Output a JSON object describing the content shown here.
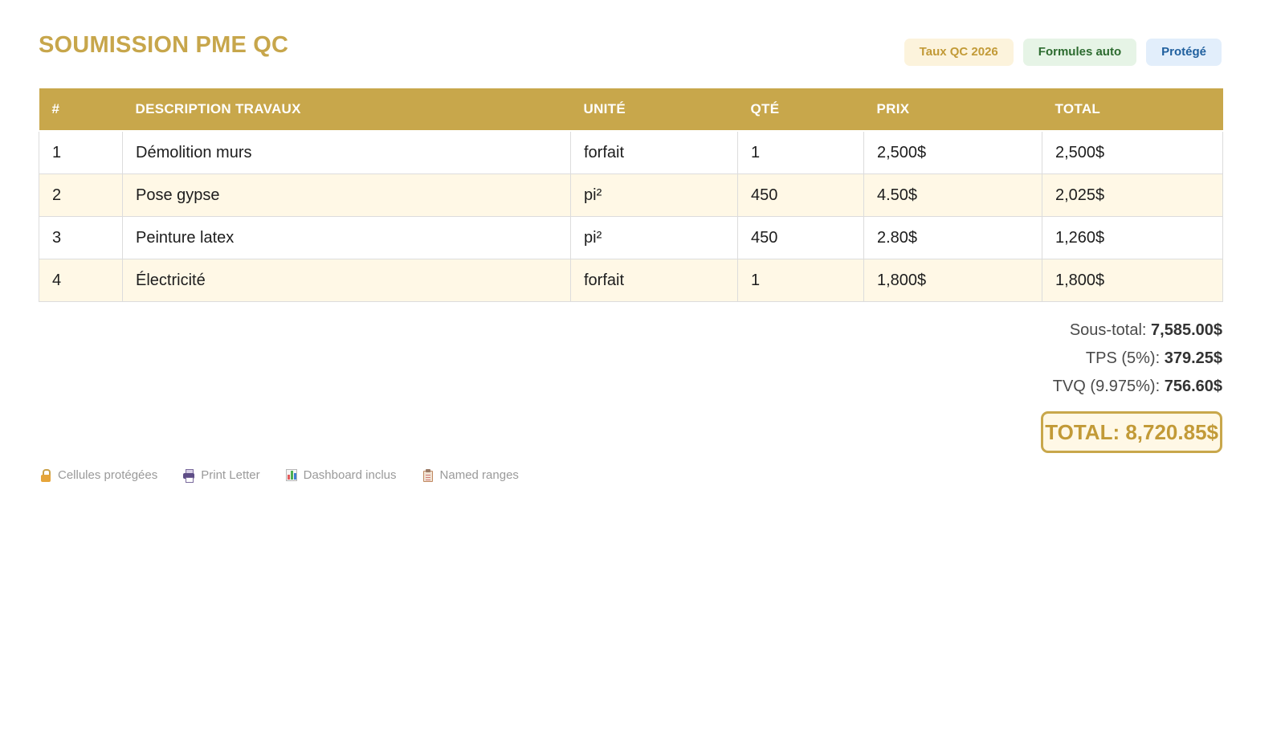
{
  "header": {
    "title": "SOUMISSION PME QC",
    "badges": {
      "rate": "Taux QC 2026",
      "formulas": "Formules auto",
      "protected": "Protégé"
    }
  },
  "table": {
    "columns": [
      "#",
      "DESCRIPTION TRAVAUX",
      "UNITÉ",
      "QTÉ",
      "PRIX",
      "TOTAL"
    ],
    "rows": [
      [
        "1",
        "Démolition murs",
        "forfait",
        "1",
        "2,500$",
        "2,500$"
      ],
      [
        "2",
        "Pose gypse",
        "pi²",
        "450",
        "4.50$",
        "2,025$"
      ],
      [
        "3",
        "Peinture latex",
        "pi²",
        "450",
        "2.80$",
        "1,260$"
      ],
      [
        "4",
        "Électricité",
        "forfait",
        "1",
        "1,800$",
        "1,800$"
      ]
    ]
  },
  "totals": {
    "subtotal_label": "Sous-total:",
    "subtotal_value": "7,585.00$",
    "tps_label": "TPS (5%):",
    "tps_value": "379.25$",
    "tvq_label": "TVQ (9.975%):",
    "tvq_value": "756.60$",
    "grand_total": "TOTAL: 8,720.85$"
  },
  "features": {
    "protected_cells": {
      "icon": "lock-icon",
      "label": "Cellules protégées"
    },
    "print": {
      "icon": "printer-icon",
      "label": "Print Letter"
    },
    "dashboard": {
      "icon": "bar-chart-icon",
      "label": "Dashboard inclus"
    },
    "named_ranges": {
      "icon": "clipboard-icon",
      "label": "Named ranges"
    }
  },
  "colors": {
    "accent_gold": "#c8a74b",
    "alt_row": "#fff8e6",
    "badge_green": "#2c6b2f",
    "badge_blue": "#1f5f9e"
  }
}
